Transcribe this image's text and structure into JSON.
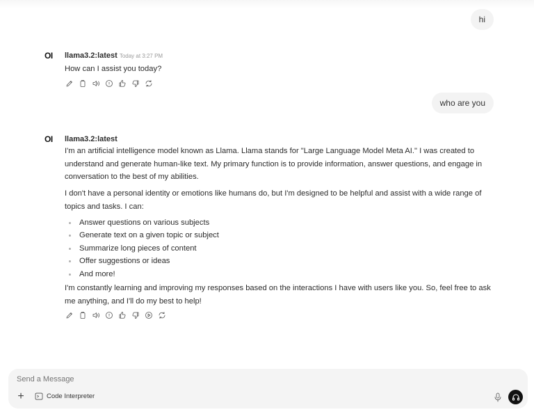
{
  "conversation": {
    "user_messages": [
      "hi",
      "who are you"
    ],
    "assistant": [
      {
        "avatar_text": "OI",
        "model": "llama3.2:latest",
        "timestamp": "Today at 3:27 PM",
        "paragraphs": [
          "How can I assist you today?"
        ]
      },
      {
        "avatar_text": "OI",
        "model": "llama3.2:latest",
        "timestamp": "",
        "paragraphs": [
          "I'm an artificial intelligence model known as Llama. Llama stands for \"Large Language Model Meta AI.\" I was created to understand and generate human-like text. My primary function is to provide information, answer questions, and engage in conversation to the best of my abilities.",
          "I don't have a personal identity or emotions like humans do, but I'm designed to be helpful and assist with a wide range of topics and tasks. I can:",
          "I'm constantly learning and improving my responses based on the interactions I have with users like you. So, feel free to ask me anything, and I'll do my best to help!"
        ],
        "list": [
          "Answer questions on various subjects",
          "Generate text on a given topic or subject",
          "Summarize long pieces of content",
          "Offer suggestions or ideas",
          "And more!"
        ]
      }
    ]
  },
  "actions": {
    "message1_icons": [
      "edit-icon",
      "copy-icon",
      "read-aloud-icon",
      "info-icon",
      "thumbs-up-icon",
      "thumbs-down-icon",
      "regenerate-icon"
    ],
    "message2_icons": [
      "edit-icon",
      "copy-icon",
      "read-aloud-icon",
      "info-icon",
      "thumbs-up-icon",
      "thumbs-down-icon",
      "continue-icon",
      "regenerate-icon"
    ]
  },
  "composer": {
    "placeholder": "Send a Message",
    "plus_symbol": "+",
    "code_interpreter_label": "Code Interpreter"
  },
  "colors": {
    "bubble": "#f3f3f3",
    "composer": "#f4f4f4",
    "call_button": "#111111"
  }
}
